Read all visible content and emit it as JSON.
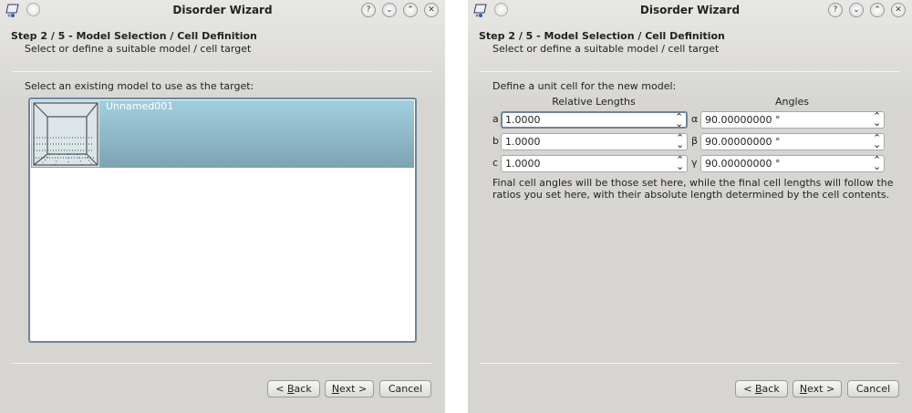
{
  "window_title": "Disorder Wizard",
  "title_buttons": {
    "help": "?",
    "minimize": "⌄",
    "maximize": "⌃",
    "close": "✕"
  },
  "step_title": "Step 2 / 5 - Model Selection / Cell Definition",
  "step_subtitle": "Select or define a suitable model / cell target",
  "left": {
    "prompt": "Select an existing model to use as the target:",
    "models": [
      {
        "name": "Unnamed001",
        "selected": true
      }
    ]
  },
  "right": {
    "prompt": "Define a unit cell for the new model:",
    "lengths_header": "Relative Lengths",
    "angles_header": "Angles",
    "rows": [
      {
        "len_label": "a",
        "length": "1.0000",
        "ang_label": "α",
        "angle": "90.00000000 °"
      },
      {
        "len_label": "b",
        "length": "1.0000",
        "ang_label": "β",
        "angle": "90.00000000 °"
      },
      {
        "len_label": "c",
        "length": "1.0000",
        "ang_label": "γ",
        "angle": "90.00000000 °"
      }
    ],
    "note": "Final cell angles will be those set here, while the final cell lengths will follow the ratios you set here, with their absolute length determined by the cell contents."
  },
  "buttons": {
    "back_prefix": "< ",
    "back_key": "B",
    "back_rest": "ack",
    "next_key": "N",
    "next_rest": "ext >",
    "cancel": "Cancel"
  }
}
